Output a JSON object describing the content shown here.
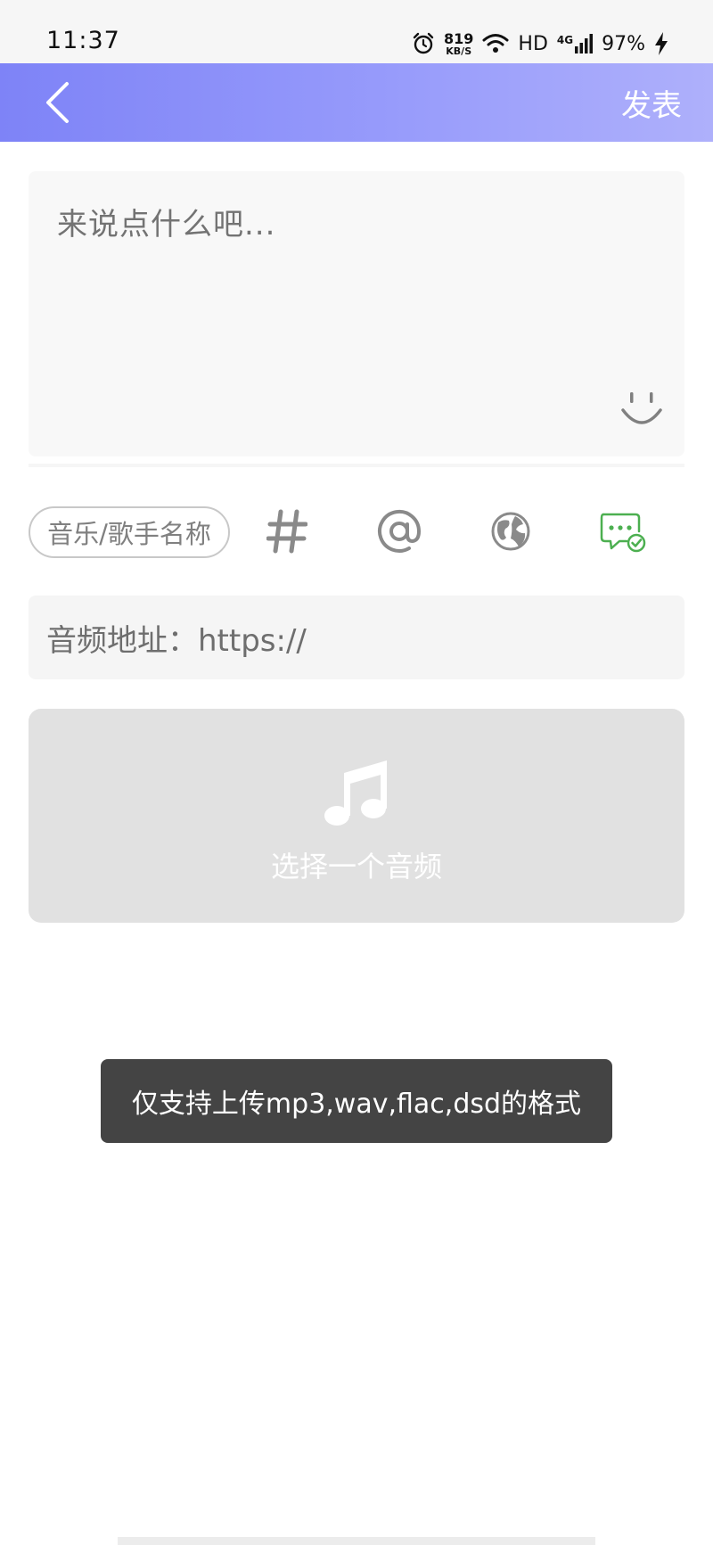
{
  "status_bar": {
    "time": "11:37",
    "net_speed_value": "819",
    "net_speed_unit": "KB/S",
    "hd_label": "HD",
    "network_type": "4G",
    "battery": "97%"
  },
  "app_bar": {
    "back_icon": "chevron-left-icon",
    "publish_label": "发表",
    "gradient_colors": [
      "#7e83f7",
      "#aeb0fb"
    ]
  },
  "compose": {
    "placeholder": "来说点什么吧...",
    "emoji_icon": "smiley-icon"
  },
  "toolbar": {
    "music_chip_label": "音乐/歌手名称",
    "icons": [
      "hashtag-icon",
      "at-mention-icon",
      "globe-icon",
      "chat-check-icon"
    ],
    "chat_icon_color": "#4caf50"
  },
  "audio_url": {
    "label": "音频地址：https://"
  },
  "audio_picker": {
    "icon": "music-note-icon",
    "label": "选择一个音频"
  },
  "toast": {
    "message": "仅支持上传mp3,wav,flac,dsd的格式"
  }
}
